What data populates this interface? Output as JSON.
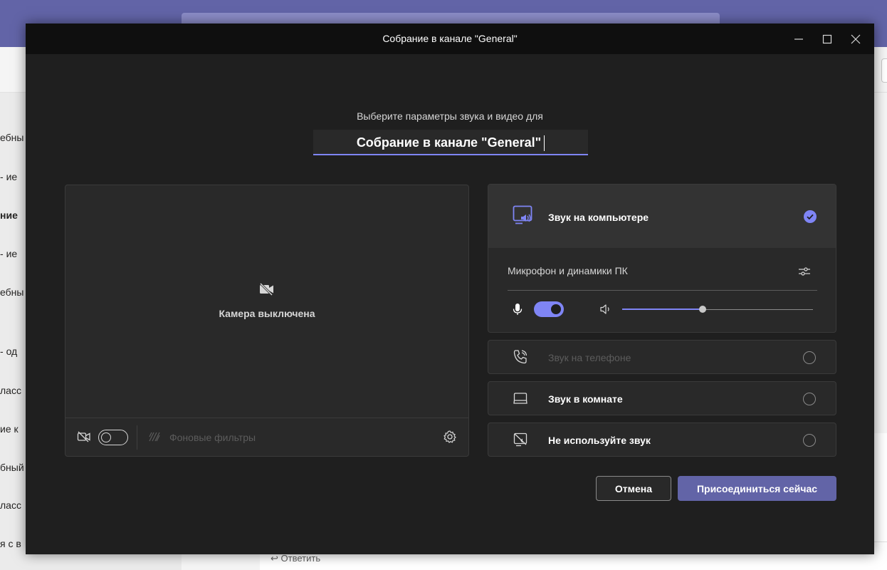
{
  "background": {
    "left_items": [
      "ебны",
      "ие -",
      "ние",
      "ие -",
      "ебны",
      "од -",
      "ласс",
      "ие к",
      "бный",
      "ласс",
      "я с в"
    ],
    "reply_label": "Ответить"
  },
  "dialog": {
    "title": "Собрание в канале \"General\"",
    "subtitle": "Выберите параметры звука и видео для",
    "meeting_name": "Собрание в канале \"General\""
  },
  "video": {
    "camera_off_label": "Камера выключена",
    "background_filters_label": "Фоновые фильтры",
    "camera_toggle_on": false
  },
  "audio": {
    "computer_audio_label": "Звук на компьютере",
    "device_label": "Микрофон и динамики ПК",
    "mic_toggle_on": true,
    "volume_level": 0.42,
    "options": [
      {
        "label": "Звук на телефоне",
        "icon": "phone-icon",
        "dim": true
      },
      {
        "label": "Звук в комнате",
        "icon": "room-icon",
        "dim": false
      },
      {
        "label": "Не используйте звук",
        "icon": "no-audio-icon",
        "dim": false
      }
    ]
  },
  "buttons": {
    "cancel": "Отмена",
    "join": "Присоединиться сейчас"
  },
  "colors": {
    "accent": "#7f85f5",
    "brand": "#6264a7"
  }
}
